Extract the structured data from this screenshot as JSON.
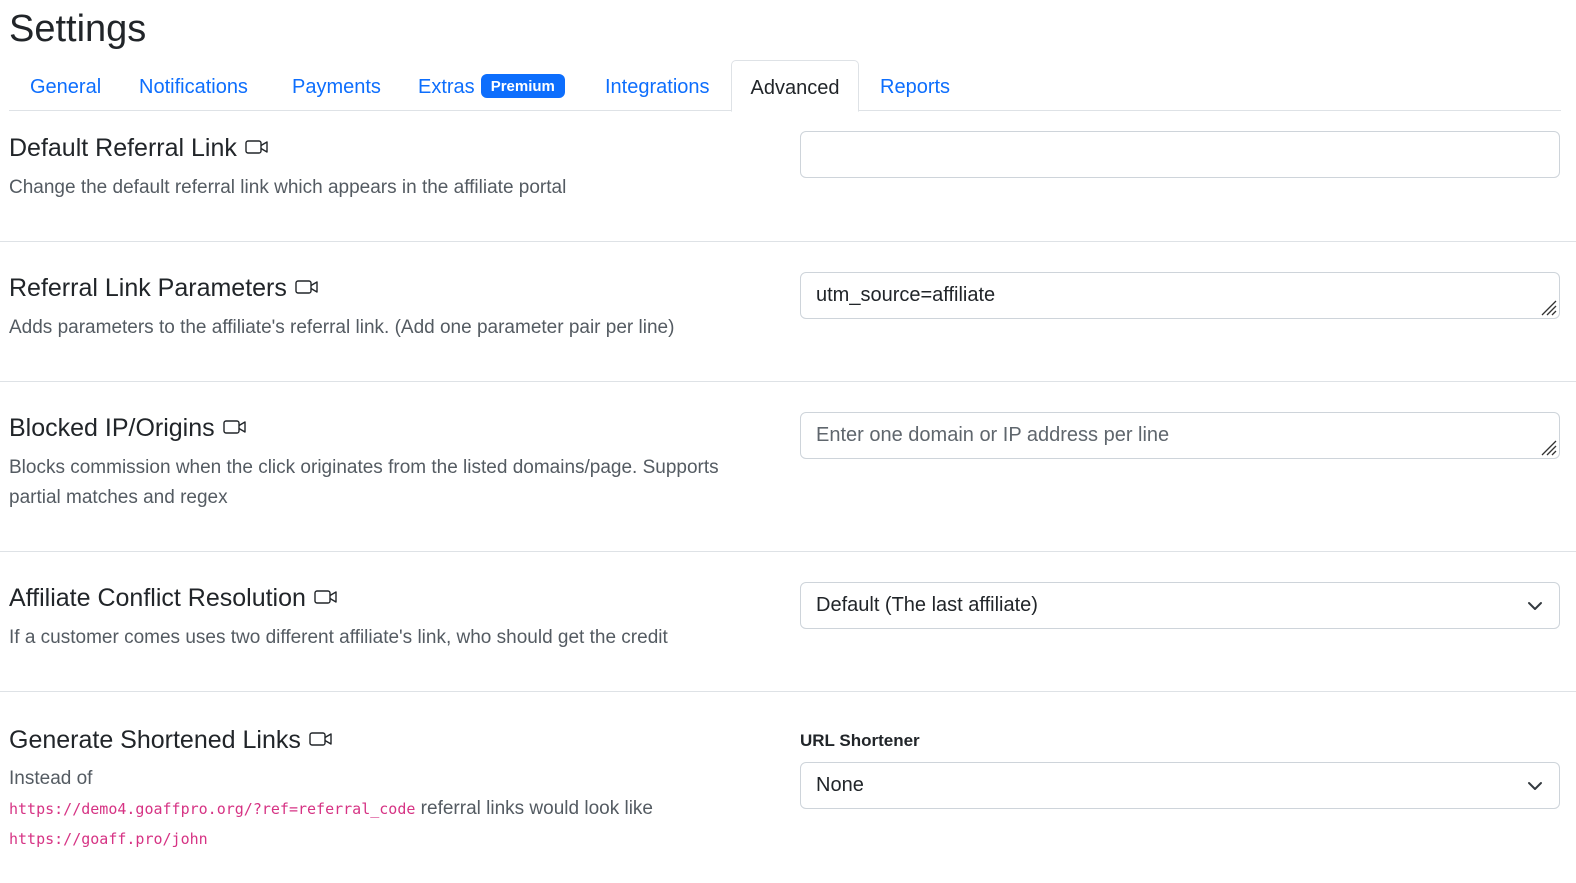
{
  "page": {
    "title": "Settings"
  },
  "tabs": [
    {
      "label": "General",
      "active": false
    },
    {
      "label": "Notifications",
      "active": false
    },
    {
      "label": "Payments",
      "active": false
    },
    {
      "label": "Extras",
      "badge": "Premium",
      "active": false
    },
    {
      "label": "Integrations",
      "active": false
    },
    {
      "label": "Advanced",
      "active": true
    },
    {
      "label": "Reports",
      "active": false
    }
  ],
  "settings": {
    "default_referral_link": {
      "title": "Default Referral Link",
      "icon": "video-icon",
      "description": "Change the default referral link which appears in the affiliate portal",
      "value": ""
    },
    "referral_link_parameters": {
      "title": "Referral Link Parameters",
      "icon": "video-icon",
      "description": "Adds parameters to the affiliate's referral link. (Add one parameter pair per line)",
      "value": "utm_source=affiliate"
    },
    "blocked_origins": {
      "title": "Blocked IP/Origins",
      "icon": "video-icon",
      "description_line1": "Blocks commission when the click originates from the listed domains/page. Supports",
      "description_line2": "partial matches and regex",
      "placeholder": "Enter one domain or IP address per line"
    },
    "conflict_resolution": {
      "title": "Affiliate Conflict Resolution",
      "icon": "video-icon",
      "description": "If a customer comes uses two different affiliate's link, who should get the credit",
      "selected": "Default (The last affiliate)"
    },
    "shortened_links": {
      "title": "Generate Shortened Links",
      "icon": "video-icon",
      "intro": "Instead of",
      "example_long": "https://demo4.goaffpro.org/?ref=referral_code",
      "connector": "referral links would look like",
      "example_short": "https://goaff.pro/john",
      "field_label": "URL Shortener",
      "selected": "None"
    }
  },
  "colors": {
    "link": "#0d6efd",
    "badge_bg": "#0d6efd",
    "code": "#d63384",
    "border": "#dee2e6"
  }
}
